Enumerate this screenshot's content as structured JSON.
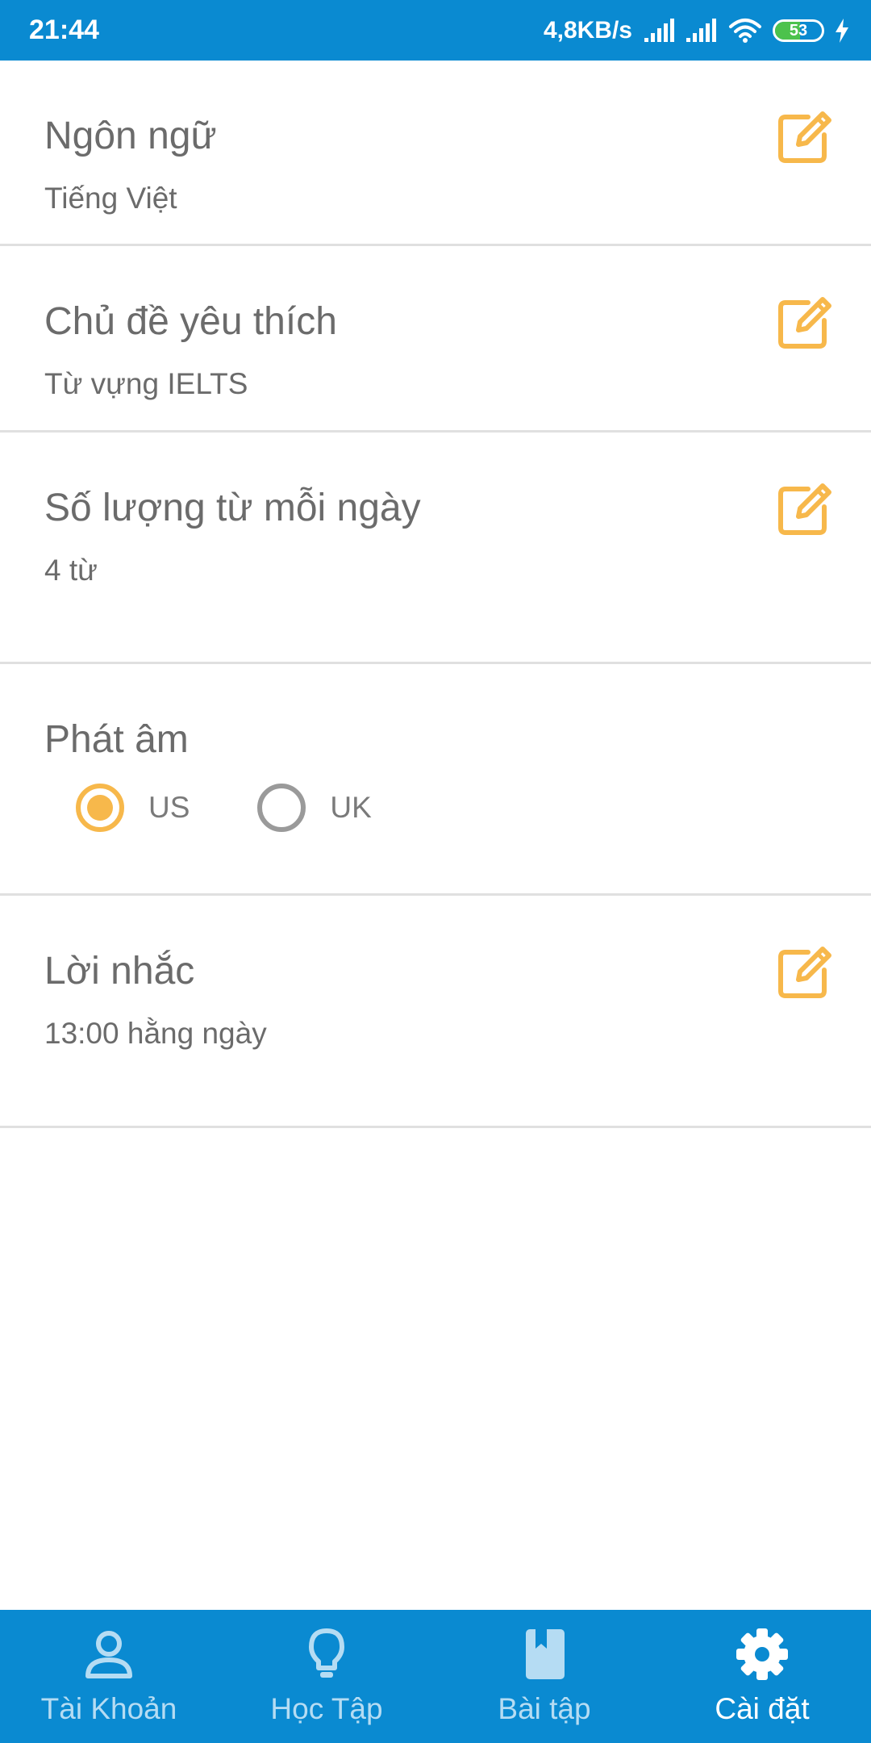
{
  "status_bar": {
    "time": "21:44",
    "network_speed": "4,8KB/s",
    "battery_level": "53",
    "battery_fraction": 0.53
  },
  "colors": {
    "primary": "#0a8ad1",
    "accent": "#f7b84b",
    "text": "#6b6b6b",
    "nav_inactive": "#b5dcf3",
    "divider": "#e0e0e0"
  },
  "settings": {
    "language": {
      "title": "Ngôn ngữ",
      "value": "Tiếng Việt",
      "icon": "edit-icon"
    },
    "topic": {
      "title": "Chủ đề yêu thích",
      "value": "Từ vựng IELTS",
      "icon": "edit-icon"
    },
    "word_count": {
      "title": "Số lượng từ mỗi ngày",
      "value": "4 từ",
      "icon": "edit-icon"
    },
    "pronunciation": {
      "title": "Phát âm",
      "options": [
        {
          "label": "US",
          "selected": true
        },
        {
          "label": "UK",
          "selected": false
        }
      ]
    },
    "reminder": {
      "title": "Lời nhắc",
      "value": "13:00 hằng ngày",
      "icon": "edit-icon"
    }
  },
  "bottom_nav": {
    "items": [
      {
        "label": "Tài Khoản",
        "icon": "user-icon",
        "active": false
      },
      {
        "label": "Học Tập",
        "icon": "lightbulb-icon",
        "active": false
      },
      {
        "label": "Bài tập",
        "icon": "book-icon",
        "active": false
      },
      {
        "label": "Cài đặt",
        "icon": "gear-icon",
        "active": true
      }
    ]
  }
}
